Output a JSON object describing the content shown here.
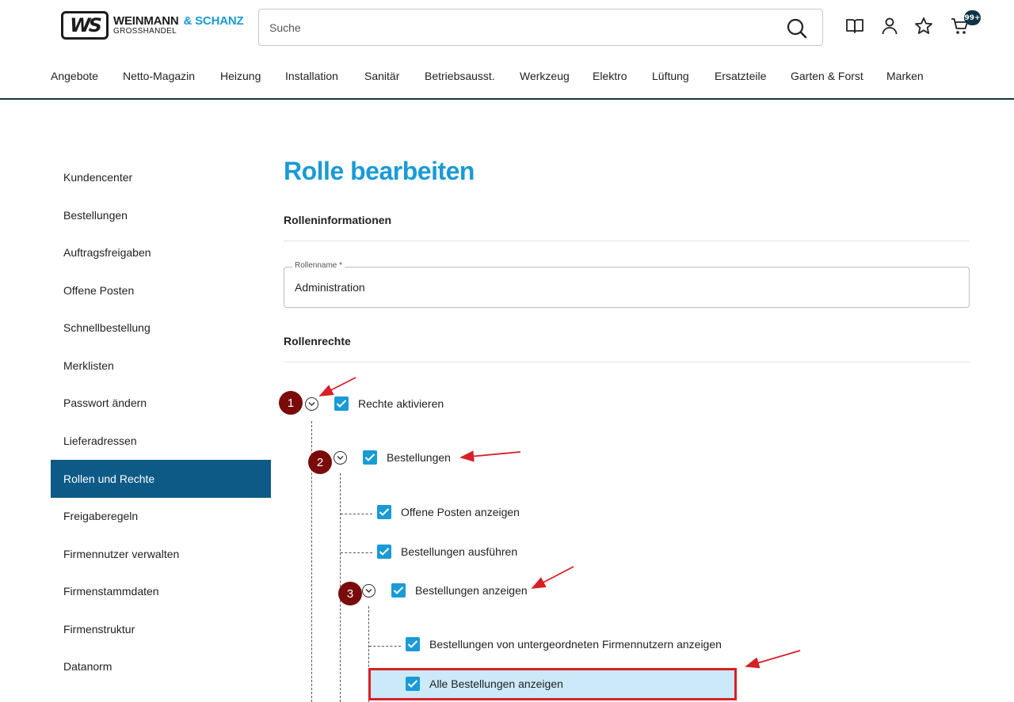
{
  "header": {
    "logo": {
      "mark": "WS",
      "brand": "WEINMANN",
      "brand_accent": "& SCHANZ",
      "subline": "GROSSHANDEL"
    },
    "search": {
      "placeholder": "Suche",
      "value": ""
    },
    "cart_badge": "99+",
    "icons": [
      "book-icon",
      "user-icon",
      "star-icon",
      "cart-icon"
    ]
  },
  "nav": {
    "items": [
      "Angebote",
      "Netto-Magazin",
      "Heizung",
      "Installation",
      "Sanitär",
      "Betriebsausst.",
      "Werkzeug",
      "Elektro",
      "Lüftung",
      "Ersatzteile",
      "Garten & Forst",
      "Marken"
    ]
  },
  "sidebar": {
    "items": [
      {
        "label": "Kundencenter",
        "active": false
      },
      {
        "label": "Bestellungen",
        "active": false
      },
      {
        "label": "Auftragsfreigaben",
        "active": false
      },
      {
        "label": "Offene Posten",
        "active": false
      },
      {
        "label": "Schnellbestellung",
        "active": false
      },
      {
        "label": "Merklisten",
        "active": false
      },
      {
        "label": "Passwort ändern",
        "active": false
      },
      {
        "label": "Lieferadressen",
        "active": false
      },
      {
        "label": "Rollen und Rechte",
        "active": true
      },
      {
        "label": "Freigaberegeln",
        "active": false
      },
      {
        "label": "Firmennutzer verwalten",
        "active": false
      },
      {
        "label": "Firmenstammdaten",
        "active": false
      },
      {
        "label": "Firmenstruktur",
        "active": false
      },
      {
        "label": "Datanorm",
        "active": false
      }
    ]
  },
  "main": {
    "title": "Rolle bearbeiten",
    "role_info_heading": "Rolleninformationen",
    "role_name": {
      "label": "Rollenname *",
      "value": "Administration"
    },
    "rights_heading": "Rollenrechte",
    "tree": [
      {
        "label": "Rechte aktivieren",
        "checked": true,
        "expandable": true
      },
      {
        "label": "Bestellungen",
        "checked": true,
        "expandable": true
      },
      {
        "label": "Offene Posten anzeigen",
        "checked": true,
        "expandable": false
      },
      {
        "label": "Bestellungen ausführen",
        "checked": true,
        "expandable": false
      },
      {
        "label": "Bestellungen anzeigen",
        "checked": true,
        "expandable": true
      },
      {
        "label": "Bestellungen von untergeordneten Firmennutzern anzeigen",
        "checked": true,
        "expandable": false
      },
      {
        "label": "Alle Bestellungen anzeigen",
        "checked": true,
        "expandable": false,
        "highlighted": true
      }
    ]
  },
  "annotations": {
    "markers": [
      "1",
      "2",
      "3"
    ],
    "accent_colors": {
      "marker": "#7a0b0b",
      "arrow": "#d81f26",
      "highlight_border": "#d81f26",
      "highlight_fill": "#cbe9f8"
    }
  }
}
